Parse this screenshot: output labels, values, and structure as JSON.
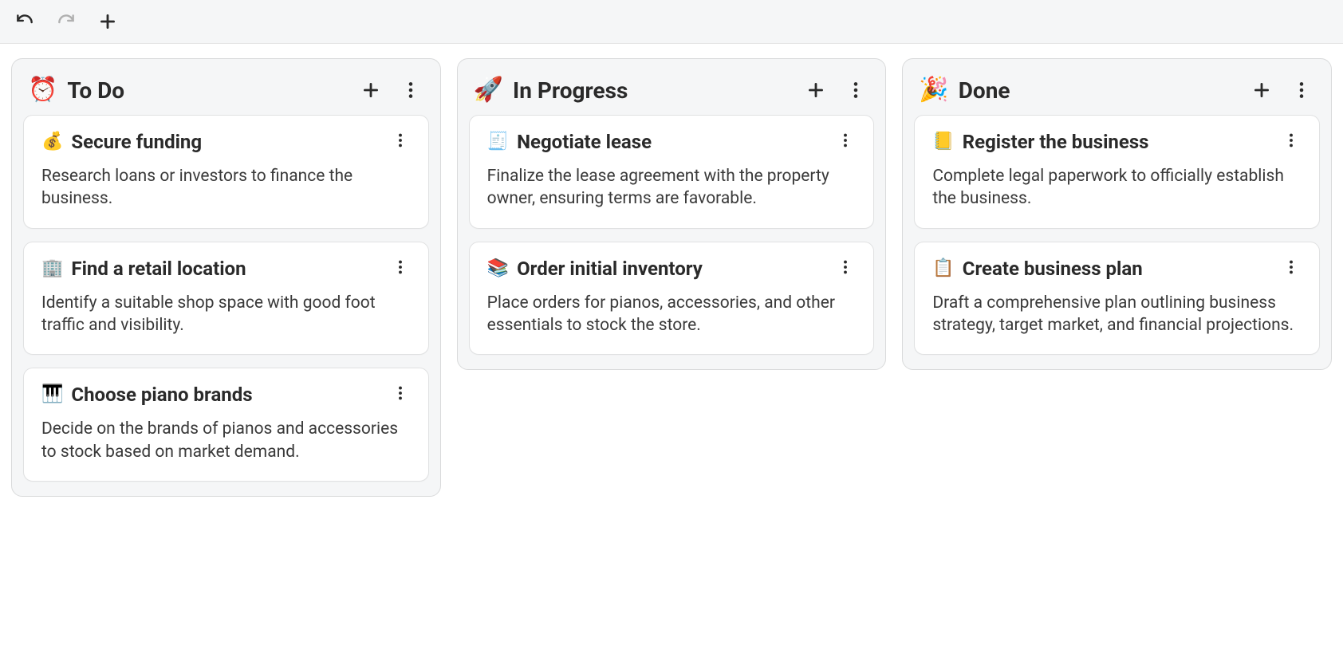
{
  "toolbar": {
    "undo": "Undo",
    "redo": "Redo",
    "add": "Add"
  },
  "columns": [
    {
      "emoji": "⏰",
      "title": "To Do",
      "cards": [
        {
          "emoji": "💰",
          "title": "Secure funding",
          "desc": "Research loans or investors to finance the business."
        },
        {
          "emoji": "🏢",
          "title": "Find a retail location",
          "desc": "Identify a suitable shop space with good foot traffic and visibility."
        },
        {
          "emoji": "🎹",
          "title": "Choose piano brands",
          "desc": "Decide on the brands of pianos and accessories to stock based on market demand."
        }
      ]
    },
    {
      "emoji": "🚀",
      "title": "In Progress",
      "cards": [
        {
          "emoji": "🧾",
          "title": "Negotiate lease",
          "desc": "Finalize the lease agreement with the property owner, ensuring terms are favorable."
        },
        {
          "emoji": "📚",
          "title": "Order initial inventory",
          "desc": "Place orders for pianos, accessories, and other essentials to stock the store."
        }
      ]
    },
    {
      "emoji": "🎉",
      "title": "Done",
      "cards": [
        {
          "emoji": "📒",
          "title": "Register the business",
          "desc": "Complete legal paperwork to officially establish the business."
        },
        {
          "emoji": "📋",
          "title": "Create business plan",
          "desc": "Draft a comprehensive plan outlining business strategy, target market, and financial projections."
        }
      ]
    }
  ]
}
